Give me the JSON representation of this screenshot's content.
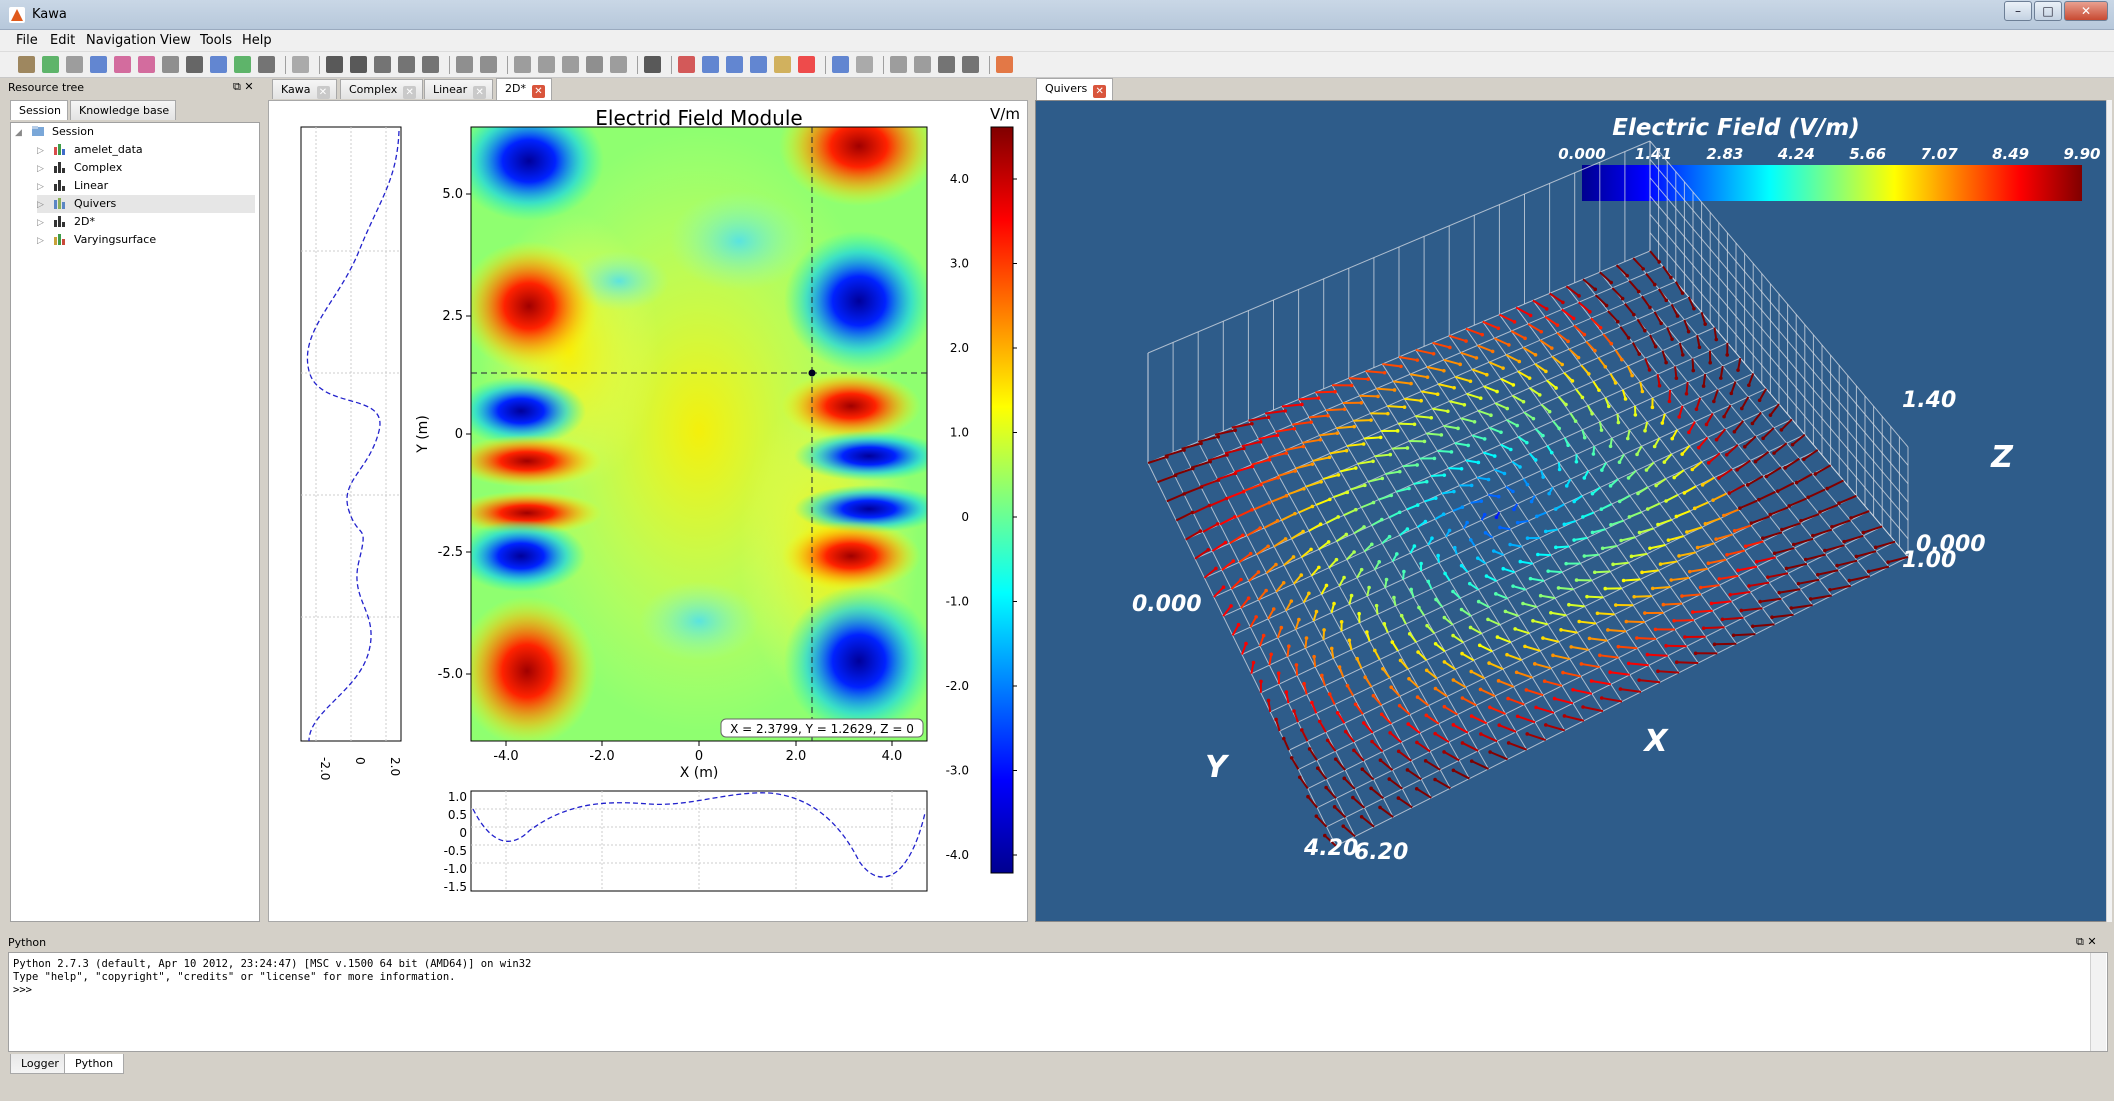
{
  "window": {
    "title": "Kawa"
  },
  "menu": [
    "File",
    "Edit",
    "Navigation",
    "View",
    "Tools",
    "Help"
  ],
  "left_panel": {
    "title": "Resource tree",
    "tabs": [
      "Session",
      "Knowledge base"
    ],
    "tree": [
      {
        "label": "Session",
        "depth": 0,
        "expanded": true
      },
      {
        "label": "amelet_data",
        "depth": 1
      },
      {
        "label": "Complex",
        "depth": 1
      },
      {
        "label": "Linear",
        "depth": 1
      },
      {
        "label": "Quivers",
        "depth": 1,
        "selected": true
      },
      {
        "label": "2D*",
        "depth": 1
      },
      {
        "label": "Varyingsurface",
        "depth": 1
      }
    ]
  },
  "center_tabs": [
    "Kawa",
    "Complex",
    "Linear",
    "2D*"
  ],
  "right_tabs": [
    "Quivers"
  ],
  "heatmap": {
    "title": "Electrid Field Module",
    "xlabel": "X (m)",
    "ylabel": "Y (m)",
    "x_ticks": [
      "-4.0",
      "-2.0",
      "0",
      "2.0",
      "4.0"
    ],
    "y_ticks": [
      "5.0",
      "2.5",
      "0",
      "-2.5",
      "-5.0"
    ],
    "colorbar_label": "V/m",
    "colorbar_ticks": [
      "4.0",
      "3.0",
      "2.0",
      "1.0",
      "0",
      "-1.0",
      "-2.0",
      "-3.0",
      "-4.0"
    ],
    "cursor_readout": "X = 2.3799, Y = 1.2629, Z = 0",
    "left_profile_ticks": [
      "-2.0",
      "0",
      "2.0"
    ],
    "bottom_profile_ticks": [
      "1.0",
      "0.5",
      "0",
      "-0.5",
      "-1.0",
      "-1.5"
    ]
  },
  "quiver": {
    "title": "Electric Field (V/m)",
    "colorbar_ticks": [
      "0.000",
      "1.41",
      "2.83",
      "4.24",
      "5.66",
      "7.07",
      "8.49",
      "9.90"
    ],
    "axis_labels": {
      "x": "X",
      "y": "Y",
      "z": "Z"
    },
    "corner_labels": {
      "z_top": "1.40",
      "z_bottom": "0.000",
      "x_far": "1.00",
      "y_left": "0.000",
      "y_near": "4.20",
      "x_near": "6.20"
    }
  },
  "python": {
    "title": "Python",
    "lines": [
      "Python 2.7.3 (default, Apr 10 2012, 23:24:47) [MSC v.1500 64 bit (AMD64)] on win32",
      "Type \"help\", \"copyright\", \"credits\" or \"license\" for more information.",
      ">>>"
    ]
  },
  "bottom_tabs": [
    "Logger",
    "Python"
  ],
  "colors": {
    "quiver_bg": "#2e5c8a",
    "accent_close": "#d9553c"
  }
}
